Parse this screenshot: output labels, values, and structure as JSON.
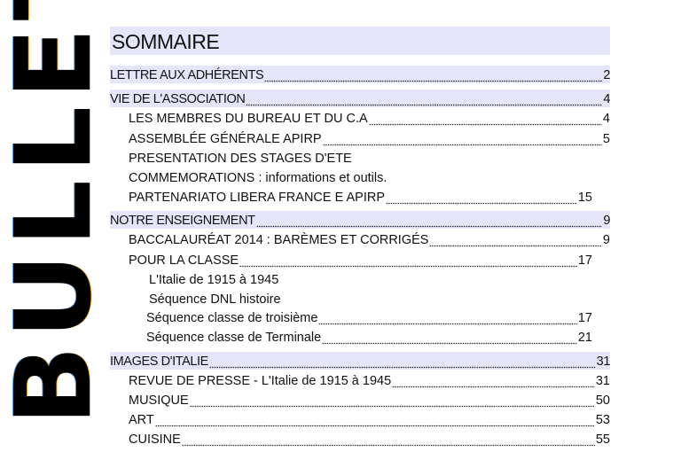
{
  "side_title": "BULLETIN",
  "title": "SOMMAIRE",
  "entries": [
    {
      "label": "LETTRE AUX ADHÉRENTS",
      "page": "2"
    },
    {
      "label": "VIE DE L'ASSOCIATION",
      "page": "4"
    },
    {
      "label": "LES MEMBRES DU BUREAU ET DU C.A",
      "page": "4"
    },
    {
      "label": "ASSEMBLÉE GÉNÉRALE APIRP",
      "page": "5"
    },
    {
      "label": "PRESENTATION DES STAGES D'ETE"
    },
    {
      "label": "COMMEMORATIONS  : informations et outils."
    },
    {
      "label": "PARTENARIATO LIBERA FRANCE E APIRP",
      "page": "15"
    },
    {
      "label": "NOTRE ENSEIGNEMENT",
      "page": "9"
    },
    {
      "label": "BACCALAURÉAT 2014 : BARÈMES ET CORRIGÉS",
      "page": "9"
    },
    {
      "label": "POUR LA CLASSE",
      "page": "17"
    },
    {
      "label": "L'Italie de 1915 à 1945"
    },
    {
      "label": "Séquence DNL histoire"
    },
    {
      "label": "Séquence classe de troisième",
      "page": "17"
    },
    {
      "label": "Séquence classe de Terminale",
      "page": "21"
    },
    {
      "label": "IMAGES D'ITALIE",
      "page": "31"
    },
    {
      "label": "REVUE DE PRESSE - L'Italie de 1915 à 1945",
      "page": "31"
    },
    {
      "label": "MUSIQUE",
      "page": "50"
    },
    {
      "label": "ART",
      "page": "53"
    },
    {
      "label": "CUISINE",
      "page": "55"
    }
  ]
}
